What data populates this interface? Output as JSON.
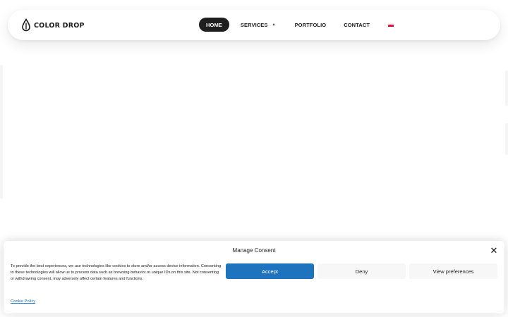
{
  "brand": {
    "logo_text": "COLOR DROP"
  },
  "nav": {
    "items": [
      {
        "label": "HOME",
        "active": true
      },
      {
        "label": "SERVICES",
        "has_dropdown": true
      },
      {
        "label": "PORTFOLIO"
      },
      {
        "label": "CONTACT"
      }
    ],
    "dropdown_icon": "caret-down-icon",
    "language_flag": "flag-icon"
  },
  "consent": {
    "title": "Manage Consent",
    "text": "To provide the best experiences, we use technologies like cookies to store and/or access device information. Consenting to these technologies will allow us to process data such as browsing behavior or unique IDs on this site. Not consenting or withdrawing consent, may adversely affect certain features and functions.",
    "accept_label": "Accept",
    "deny_label": "Deny",
    "preferences_label": "View preferences",
    "policy_link": "Cookie Policy",
    "close_icon": "close-icon"
  },
  "colors": {
    "accent": "#1e73be",
    "nav_active_bg": "#1f1f1f",
    "text": "#222222"
  }
}
